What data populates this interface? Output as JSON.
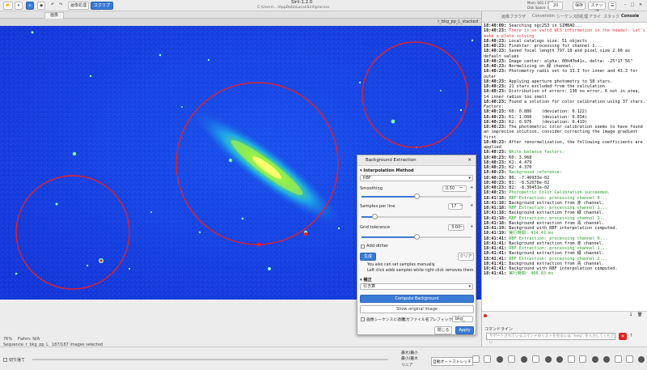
{
  "window": {
    "title": "Siril-1.2.0",
    "path": "C:\\Users\\...\\AppData\\Local\\Siril\\process",
    "memory": "Mem: 602.1 MiB",
    "disk": "Disk Space: 402.2 GB",
    "zoom": "20",
    "menu_label": "画像処理",
    "script_label": "スクリプト",
    "save_label": "保存",
    "snapshot_label": "スナップ",
    "sequence_dropdown": "ビーヴァー"
  },
  "tabs": {
    "image_tab": "画像"
  },
  "image_path": "r_bkg_pp_L_stacked",
  "status": {
    "zoom": "76%",
    "fwhm": "Fwhm: N/A",
    "sequence": "Sequence: r_bkg_pp_L_ 187/187 images selected"
  },
  "bottom": {
    "cut_label": "切り捨て",
    "linear_label": "リニア",
    "autostretch_label": "自動オートストレッチ",
    "radio_option1": "最大/最小",
    "radio_option2": "最小/最大"
  },
  "right_panel": {
    "tabs": [
      "画像ブラウザ",
      "Conversion",
      "シーケンス",
      "前処理",
      "アライ",
      "スタック",
      "Console"
    ],
    "command_label": "コマンドライン",
    "command_placeholder": "サポートされているコマンドのリストを見るには \"help\" を入力してください",
    "clear_icon_label": "×"
  },
  "console_lines": [
    {
      "t": "18:40:09: ",
      "m": "Searching ngc253 in SIMBAD...",
      "c": ""
    },
    {
      "t": "18:40:23: ",
      "m": "There is no valid WCS information in the header. Let's make a plate solving.",
      "c": "red"
    },
    {
      "t": "18:40:23: ",
      "m": "Local catalogs size: 51 objects",
      "c": ""
    },
    {
      "t": "18:40:23: ",
      "m": "Findstar: processing for channel 1...",
      "c": ""
    },
    {
      "t": "18:40:23: ",
      "m": "Saved focal length 797.18 and pixel size 2.90 as default values",
      "c": ""
    },
    {
      "t": "18:40:23: ",
      "m": "Image center: alpha: 00h47m41s, delta: -25°17'56\"",
      "c": ""
    },
    {
      "t": "18:40:23: ",
      "m": "Normalizing on 緑 channel.",
      "c": ""
    },
    {
      "t": "18:40:23: ",
      "m": "Photometry radii set to 33.3 for inner and 43.3 for outer",
      "c": ""
    },
    {
      "t": "18:40:23: ",
      "m": "Applying aperture photometry to 58 stars.",
      "c": ""
    },
    {
      "t": "18:40:23: ",
      "m": "21 stars excluded from the calculation",
      "c": ""
    },
    {
      "t": "18:40:23: ",
      "m": "Distribution of errors: 130 no error, 6 not in area, 14 inner radius too small",
      "c": ""
    },
    {
      "t": "18:40:23: ",
      "m": "Found a solution for color calibration using 37 stars. Factors:",
      "c": ""
    },
    {
      "t": "18:40:23: ",
      "m": "K0: 0.886    (deviation: 0.122)",
      "c": ""
    },
    {
      "t": "18:40:23: ",
      "m": "K1: 1.000    (deviation: 0.034)",
      "c": ""
    },
    {
      "t": "18:40:23: ",
      "m": "K2: 0.976    (deviation: 0.419)",
      "c": ""
    },
    {
      "t": "18:40:23: ",
      "m": "The photometric color calibration seems to have found an imprecise solution, consider correcting the image gradient first",
      "c": ""
    },
    {
      "t": "18:40:23: ",
      "m": "After renormalization, the following coefficients are applied",
      "c": ""
    },
    {
      "t": "18:40:23: ",
      "m": "White balance factors:",
      "c": "green"
    },
    {
      "t": "18:40:23: ",
      "m": "K0: 3.968",
      "c": ""
    },
    {
      "t": "18:40:23: ",
      "m": "K1: 4.479",
      "c": ""
    },
    {
      "t": "18:40:23: ",
      "m": "K2: 4.370",
      "c": ""
    },
    {
      "t": "18:40:23: ",
      "m": "Background reference:",
      "c": "green"
    },
    {
      "t": "18:40:23: ",
      "m": "B0: -7.46933e-02",
      "c": ""
    },
    {
      "t": "18:40:23: ",
      "m": "B1: -8.52078e-02",
      "c": ""
    },
    {
      "t": "18:40:23: ",
      "m": "B2: -8.30451e-02",
      "c": ""
    },
    {
      "t": "18:40:23: ",
      "m": "Photometric Color Calibration succeeded.",
      "c": "green"
    },
    {
      "t": "18:41:18: ",
      "m": "RBF Extraction: processing channel 0...",
      "c": "green"
    },
    {
      "t": "18:41:18: ",
      "m": "Background extraction from 赤 channel.",
      "c": ""
    },
    {
      "t": "18:41:18: ",
      "m": "RBF Extraction: processing channel 1...",
      "c": "green"
    },
    {
      "t": "18:41:18: ",
      "m": "Background extraction from 緑 channel.",
      "c": ""
    },
    {
      "t": "18:41:18: ",
      "m": "RBF Extraction: processing channel 2...",
      "c": "green"
    },
    {
      "t": "18:41:18: ",
      "m": "Background extraction from 青 channel.",
      "c": ""
    },
    {
      "t": "18:41:19: ",
      "m": "Background with RBF interpolation computed.",
      "c": ""
    },
    {
      "t": "18:41:19: ",
      "m": "実行時間: 414.41 ms",
      "c": "green"
    },
    {
      "t": "18:41:41: ",
      "m": "RBF Extraction: processing channel 0...",
      "c": "green"
    },
    {
      "t": "18:41:41: ",
      "m": "Background extraction from 赤 channel.",
      "c": ""
    },
    {
      "t": "18:41:41: ",
      "m": "RBF Extraction: processing channel 1...",
      "c": "green"
    },
    {
      "t": "18:41:41: ",
      "m": "Background extraction from 緑 channel.",
      "c": ""
    },
    {
      "t": "18:41:41: ",
      "m": "RBF Extraction: processing channel 2...",
      "c": "green"
    },
    {
      "t": "18:41:41: ",
      "m": "Background extraction from 青 channel.",
      "c": ""
    },
    {
      "t": "18:41:41: ",
      "m": "Background with RBF interpolation computed.",
      "c": ""
    },
    {
      "t": "18:41:41: ",
      "m": "実行時間: 406.83 ms",
      "c": "green"
    }
  ],
  "dialog": {
    "title": "Background Extraction",
    "section_interp": "Interpolation Method",
    "method": "RBF",
    "smoothing_label": "Smoothing",
    "smoothing_value": "0.50",
    "smoothing_fraction": 0.5,
    "samples_label": "Samples per line",
    "samples_value": "17",
    "samples_fraction": 0.12,
    "tolerance_label": "Grid tolerance",
    "tolerance_value": "3.00",
    "tolerance_fraction": 0.5,
    "dither_label": "Add dither",
    "generate_label": "生成",
    "clear_label": "クリア",
    "hint1": "You also can set samples manually.",
    "hint2": "Left click adds samples while right click removes them.",
    "section_correction": "補正",
    "correction_method": "引き算",
    "compute_label": "Compute Background",
    "show_original_label": "Show original image",
    "apply_seq_label": "画像シーケンスに適用",
    "prefix_label": "出力ファイル名プレフィックス",
    "prefix_value": "bkg_",
    "close_label": "閉じる",
    "apply_label": "Apply"
  }
}
